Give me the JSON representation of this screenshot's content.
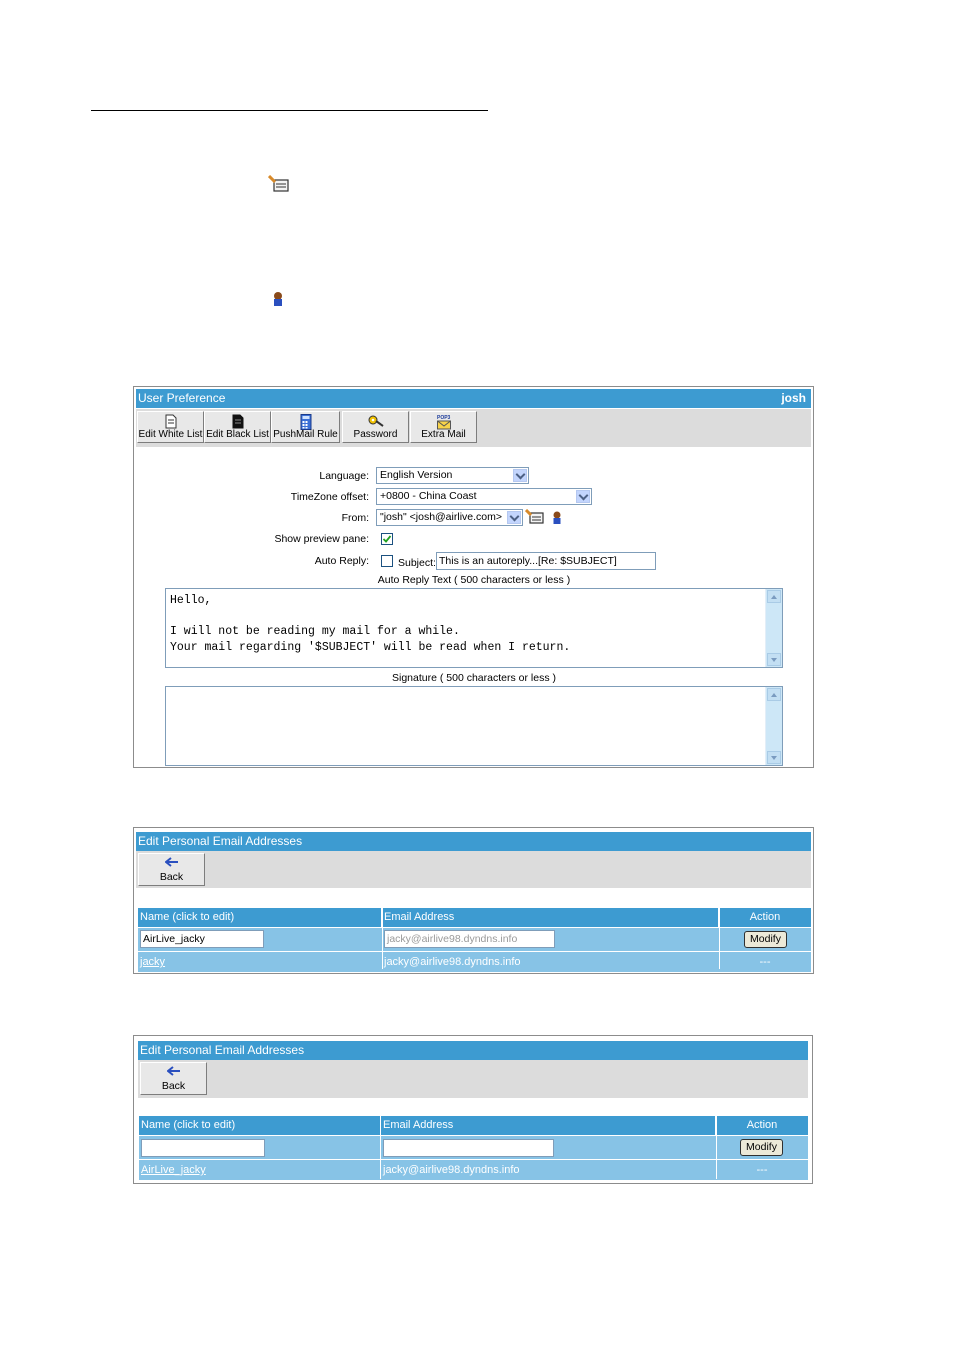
{
  "colors": {
    "title_bar": "#3d9bd1",
    "row_bg": "#87c3e6",
    "toolbar_bg": "#dcdcdc"
  },
  "icons": [
    "address-book-icon",
    "contact-person-icon",
    "document-icon",
    "black-document-icon",
    "calculator-icon",
    "key-icon",
    "pop3-mail-icon",
    "back-arrow-icon"
  ],
  "preference": {
    "title": "User Preference",
    "user": "josh",
    "toolbar": [
      "Edit White List",
      "Edit Black List",
      "PushMail Rule",
      "Password",
      "Extra Mail"
    ],
    "language_label": "Language:",
    "language_value": "English Version",
    "timezone_label": "TimeZone offset:",
    "timezone_value": "+0800 - China Coast",
    "from_label": "From:",
    "from_value": "\"josh\" <josh@airlive.com>",
    "preview_label": "Show preview pane:",
    "autoreply_label": "Auto Reply:",
    "subject_label": "Subject:",
    "subject_value": "This is an autoreply...[Re: $SUBJECT]",
    "autoreply_text_label": "Auto Reply Text ( 500 characters or less )",
    "autoreply_text": "Hello,\n\nI will not be reading my mail for a while.\nYour mail regarding '$SUBJECT' will be read when I return.",
    "signature_label": "Signature ( 500 characters or less )"
  },
  "edit1": {
    "title": "Edit Personal Email Addresses",
    "back": "Back",
    "col_name": "Name (click to edit)",
    "col_email": "Email Address",
    "col_action": "Action",
    "name_input": "AirLive_jacky",
    "email_input": "jacky@airlive98.dyndns.info",
    "modify": "Modify",
    "row_name": "jacky",
    "row_email": "jacky@airlive98.dyndns.info",
    "row_action": "---"
  },
  "edit2": {
    "title": "Edit Personal Email Addresses",
    "back": "Back",
    "col_name": "Name (click to edit)",
    "col_email": "Email Address",
    "col_action": "Action",
    "name_input": "",
    "email_input": "",
    "modify": "Modify",
    "row_name": "AirLive_jacky",
    "row_email": "jacky@airlive98.dyndns.info",
    "row_action": "---"
  }
}
